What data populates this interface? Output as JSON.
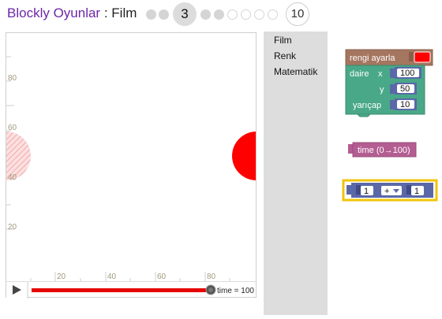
{
  "header": {
    "app_name": "Blockly Oyunlar",
    "separator": " : ",
    "game_name": "Film",
    "current_level": "3",
    "last_level": "10"
  },
  "visualization": {
    "y_ticks": [
      "80",
      "60",
      "40",
      "20"
    ],
    "x_ticks": [
      "20",
      "40",
      "60",
      "80"
    ],
    "time_label": "time = 100"
  },
  "toolbox": {
    "categories": [
      "Film",
      "Renk",
      "Matematik"
    ]
  },
  "blocks": {
    "set_color": "rengi ayarla",
    "circle": "daire",
    "x_label": "x",
    "x_value": "100",
    "y_label": "y",
    "y_value": "50",
    "radius_label": "yarıçap",
    "radius_value": "10",
    "time_block": "time (0→100)",
    "math_left": "1",
    "math_op": "+",
    "math_right": "1"
  },
  "colors": {
    "accent": "#6c26a8",
    "circle_red": "#ff0000",
    "ghost_circle": "#f7c4c4",
    "scrubber_red": "#e60000",
    "color_block": "#a5765f",
    "movie_block": "#49a887",
    "math_block": "#5a68a8",
    "time_block": "#b35d92",
    "selected_outline": "#f2c40a"
  }
}
